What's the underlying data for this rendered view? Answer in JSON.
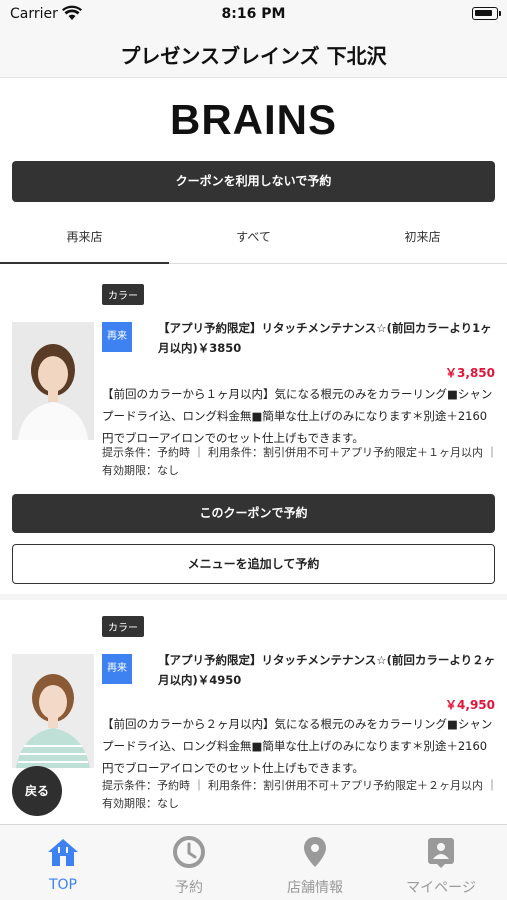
{
  "status_bar": {
    "carrier": "Carrier",
    "time": "8:16 PM"
  },
  "nav": {
    "title": "プレゼンスブレインズ 下北沢"
  },
  "brand": {
    "logo": "BRAINS"
  },
  "primary_action": {
    "label": "クーポンを利用しないで予約"
  },
  "tabs": [
    {
      "label": "再来店",
      "active": true
    },
    {
      "label": "すべて",
      "active": false
    },
    {
      "label": "初来店",
      "active": false
    }
  ],
  "coupons": [
    {
      "category": "カラー",
      "badge": "再来",
      "name": "【アプリ予約限定】リタッチメンテナンス☆(前回カラーより1ヶ月以内)￥3850",
      "price": "￥3,850",
      "description": "【前回のカラーから１ヶ月以内】気になる根元のみをカラーリング■シャンプードライ込、ロング料金無■簡単な仕上げのみになります＊別途＋2160円でブローアイロンでのセット仕上げもできます。",
      "conditions": "提示条件：予約時 ｜ 利用条件：割引併用不可＋アプリ予約限定＋１ヶ月以内 ｜ 有効期限：なし",
      "reserve_label": "このクーポンで予約",
      "add_menu_label": "メニューを追加して予約"
    },
    {
      "category": "カラー",
      "badge": "再来",
      "name": "【アプリ予約限定】リタッチメンテナンス☆(前回カラーより２ヶ月以内)￥4950",
      "price": "￥4,950",
      "description": "【前回のカラーから２ヶ月以内】気になる根元のみをカラーリング■シャンプードライ込、ロング料金無■簡単な仕上げのみになります＊別途＋2160円でブローアイロンでのセット仕上げもできます。",
      "conditions": "提示条件：予約時 ｜ 利用条件：割引併用不可＋アプリ予約限定＋２ヶ月以内 ｜ 有効期限：なし"
    }
  ],
  "back_button": {
    "label": "戻る"
  },
  "tab_bar": [
    {
      "label": "TOP",
      "icon": "home-icon",
      "active": true
    },
    {
      "label": "予約",
      "icon": "clock-icon",
      "active": false
    },
    {
      "label": "店舗情報",
      "icon": "map-pin-icon",
      "active": false
    },
    {
      "label": "マイページ",
      "icon": "profile-badge-icon",
      "active": false
    }
  ],
  "colors": {
    "accent": "#3d82f0",
    "price": "#e0163a",
    "dark_button": "#333333"
  }
}
